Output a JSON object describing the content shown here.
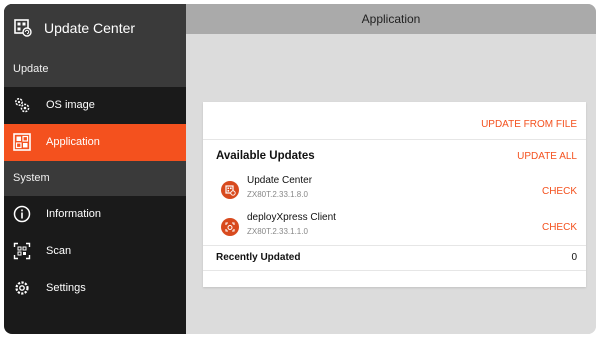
{
  "sidebar": {
    "app_title": "Update Center",
    "sections": [
      {
        "label": "Update"
      },
      {
        "label": "System"
      }
    ],
    "items": [
      {
        "label": "OS image",
        "icon": "gears-icon"
      },
      {
        "label": "Application",
        "icon": "apps-grid-icon",
        "active": true
      },
      {
        "label": "Information",
        "icon": "info-icon"
      },
      {
        "label": "Scan",
        "icon": "scan-icon"
      },
      {
        "label": "Settings",
        "icon": "gear-icon"
      }
    ]
  },
  "header": {
    "title": "Application"
  },
  "card": {
    "update_from_file": "UPDATE FROM FILE",
    "available_updates_title": "Available Updates",
    "update_all": "UPDATE ALL",
    "apps": [
      {
        "name": "Update Center",
        "version": "ZX80T.2.33.1.8.0",
        "action": "CHECK",
        "icon": "update-center-app-icon"
      },
      {
        "name": "deployXpress Client",
        "version": "ZX80T.2.33.1.1.0",
        "action": "CHECK",
        "icon": "deployxpress-app-icon"
      }
    ],
    "recently_updated_title": "Recently Updated",
    "recently_updated_count": "0"
  },
  "colors": {
    "accent": "#f4511e",
    "sidebar_bg": "#1a1a1a",
    "section_bg": "#3a3a3a",
    "topbar_bg": "#aaaaaa",
    "content_bg": "#dcdcdc"
  }
}
